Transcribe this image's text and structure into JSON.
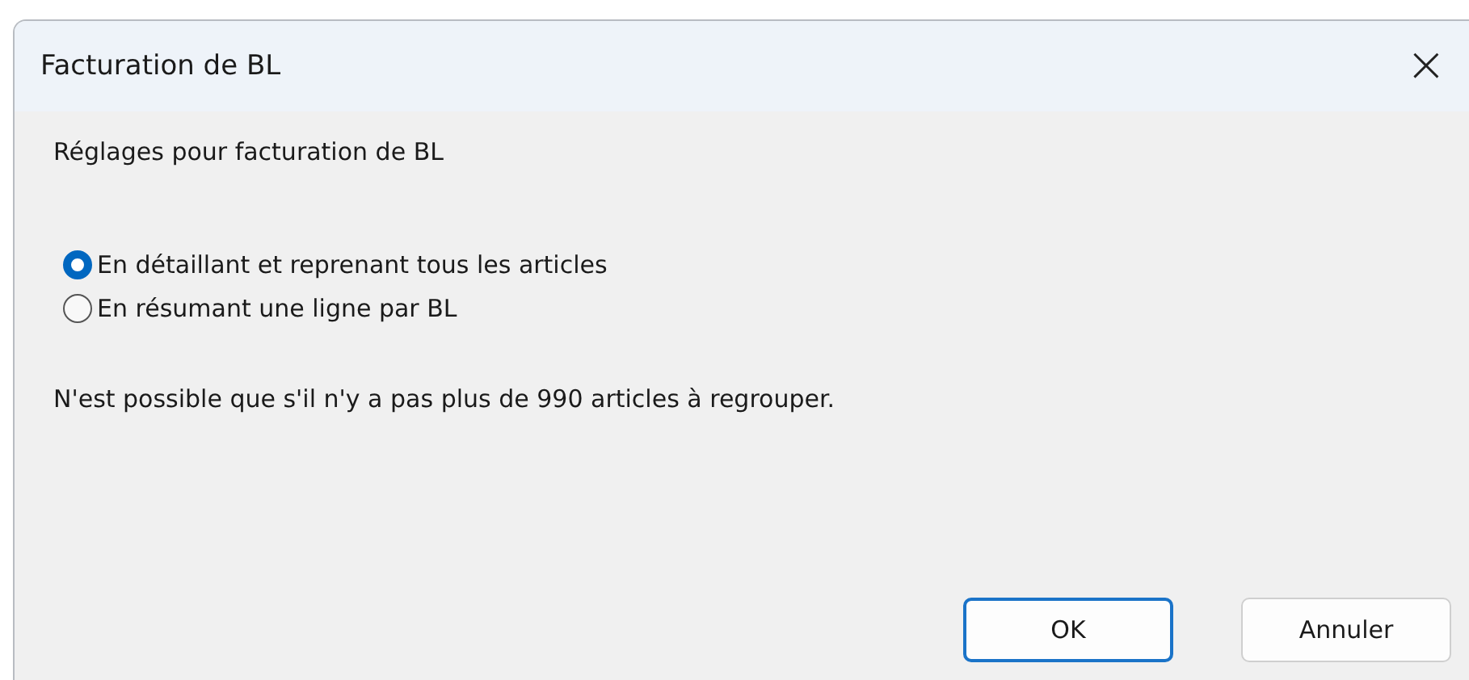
{
  "window": {
    "title": "Facturation de BL",
    "close": "×"
  },
  "heading": "Réglages pour facturation de BL",
  "options": [
    {
      "label": "En détaillant et reprenant tous les articles",
      "selected": true
    },
    {
      "label": "En résumant une ligne par BL",
      "selected": false
    }
  ],
  "note": "N'est possible que s'il n'y a pas plus de 990 articles à regrouper.",
  "buttons": [
    {
      "label": "OK",
      "default": true
    },
    {
      "label": "Annuler",
      "default": false
    }
  ]
}
